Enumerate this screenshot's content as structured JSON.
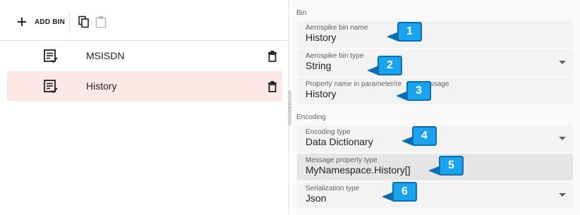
{
  "toolbar": {
    "add_label": "ADD BIN"
  },
  "bins": [
    {
      "name": "MSISDN",
      "selected": false
    },
    {
      "name": "History",
      "selected": true
    }
  ],
  "bin_section": {
    "title": "Bin",
    "name_field": {
      "label": "Aerospike bin name",
      "value": "History"
    },
    "type_field": {
      "label": "Aerospike bin type",
      "value": "String"
    },
    "property_field": {
      "label": "Property name in parameter/re",
      "label_end": "essage",
      "value": "History"
    }
  },
  "encoding_section": {
    "title": "Encoding",
    "encoding_type": {
      "label": "Encoding type",
      "value": "Data Dictionary"
    },
    "message_property_type": {
      "label": "Message property type",
      "value": "MyNamespace.History[]"
    },
    "serialization_type": {
      "label": "Serialization type",
      "value": "Json"
    }
  },
  "badges": [
    "1",
    "2",
    "3",
    "4",
    "5",
    "6"
  ],
  "colors": {
    "selected_row": "#fce9e7",
    "badge": "#1aa3ef",
    "badge_border": "#0d6fb0",
    "field_bg": "#f3f3f3"
  },
  "icons": [
    "add-icon",
    "copy-icon",
    "paste-icon",
    "document-check-icon",
    "delete-icon",
    "dropdown-caret-icon"
  ]
}
